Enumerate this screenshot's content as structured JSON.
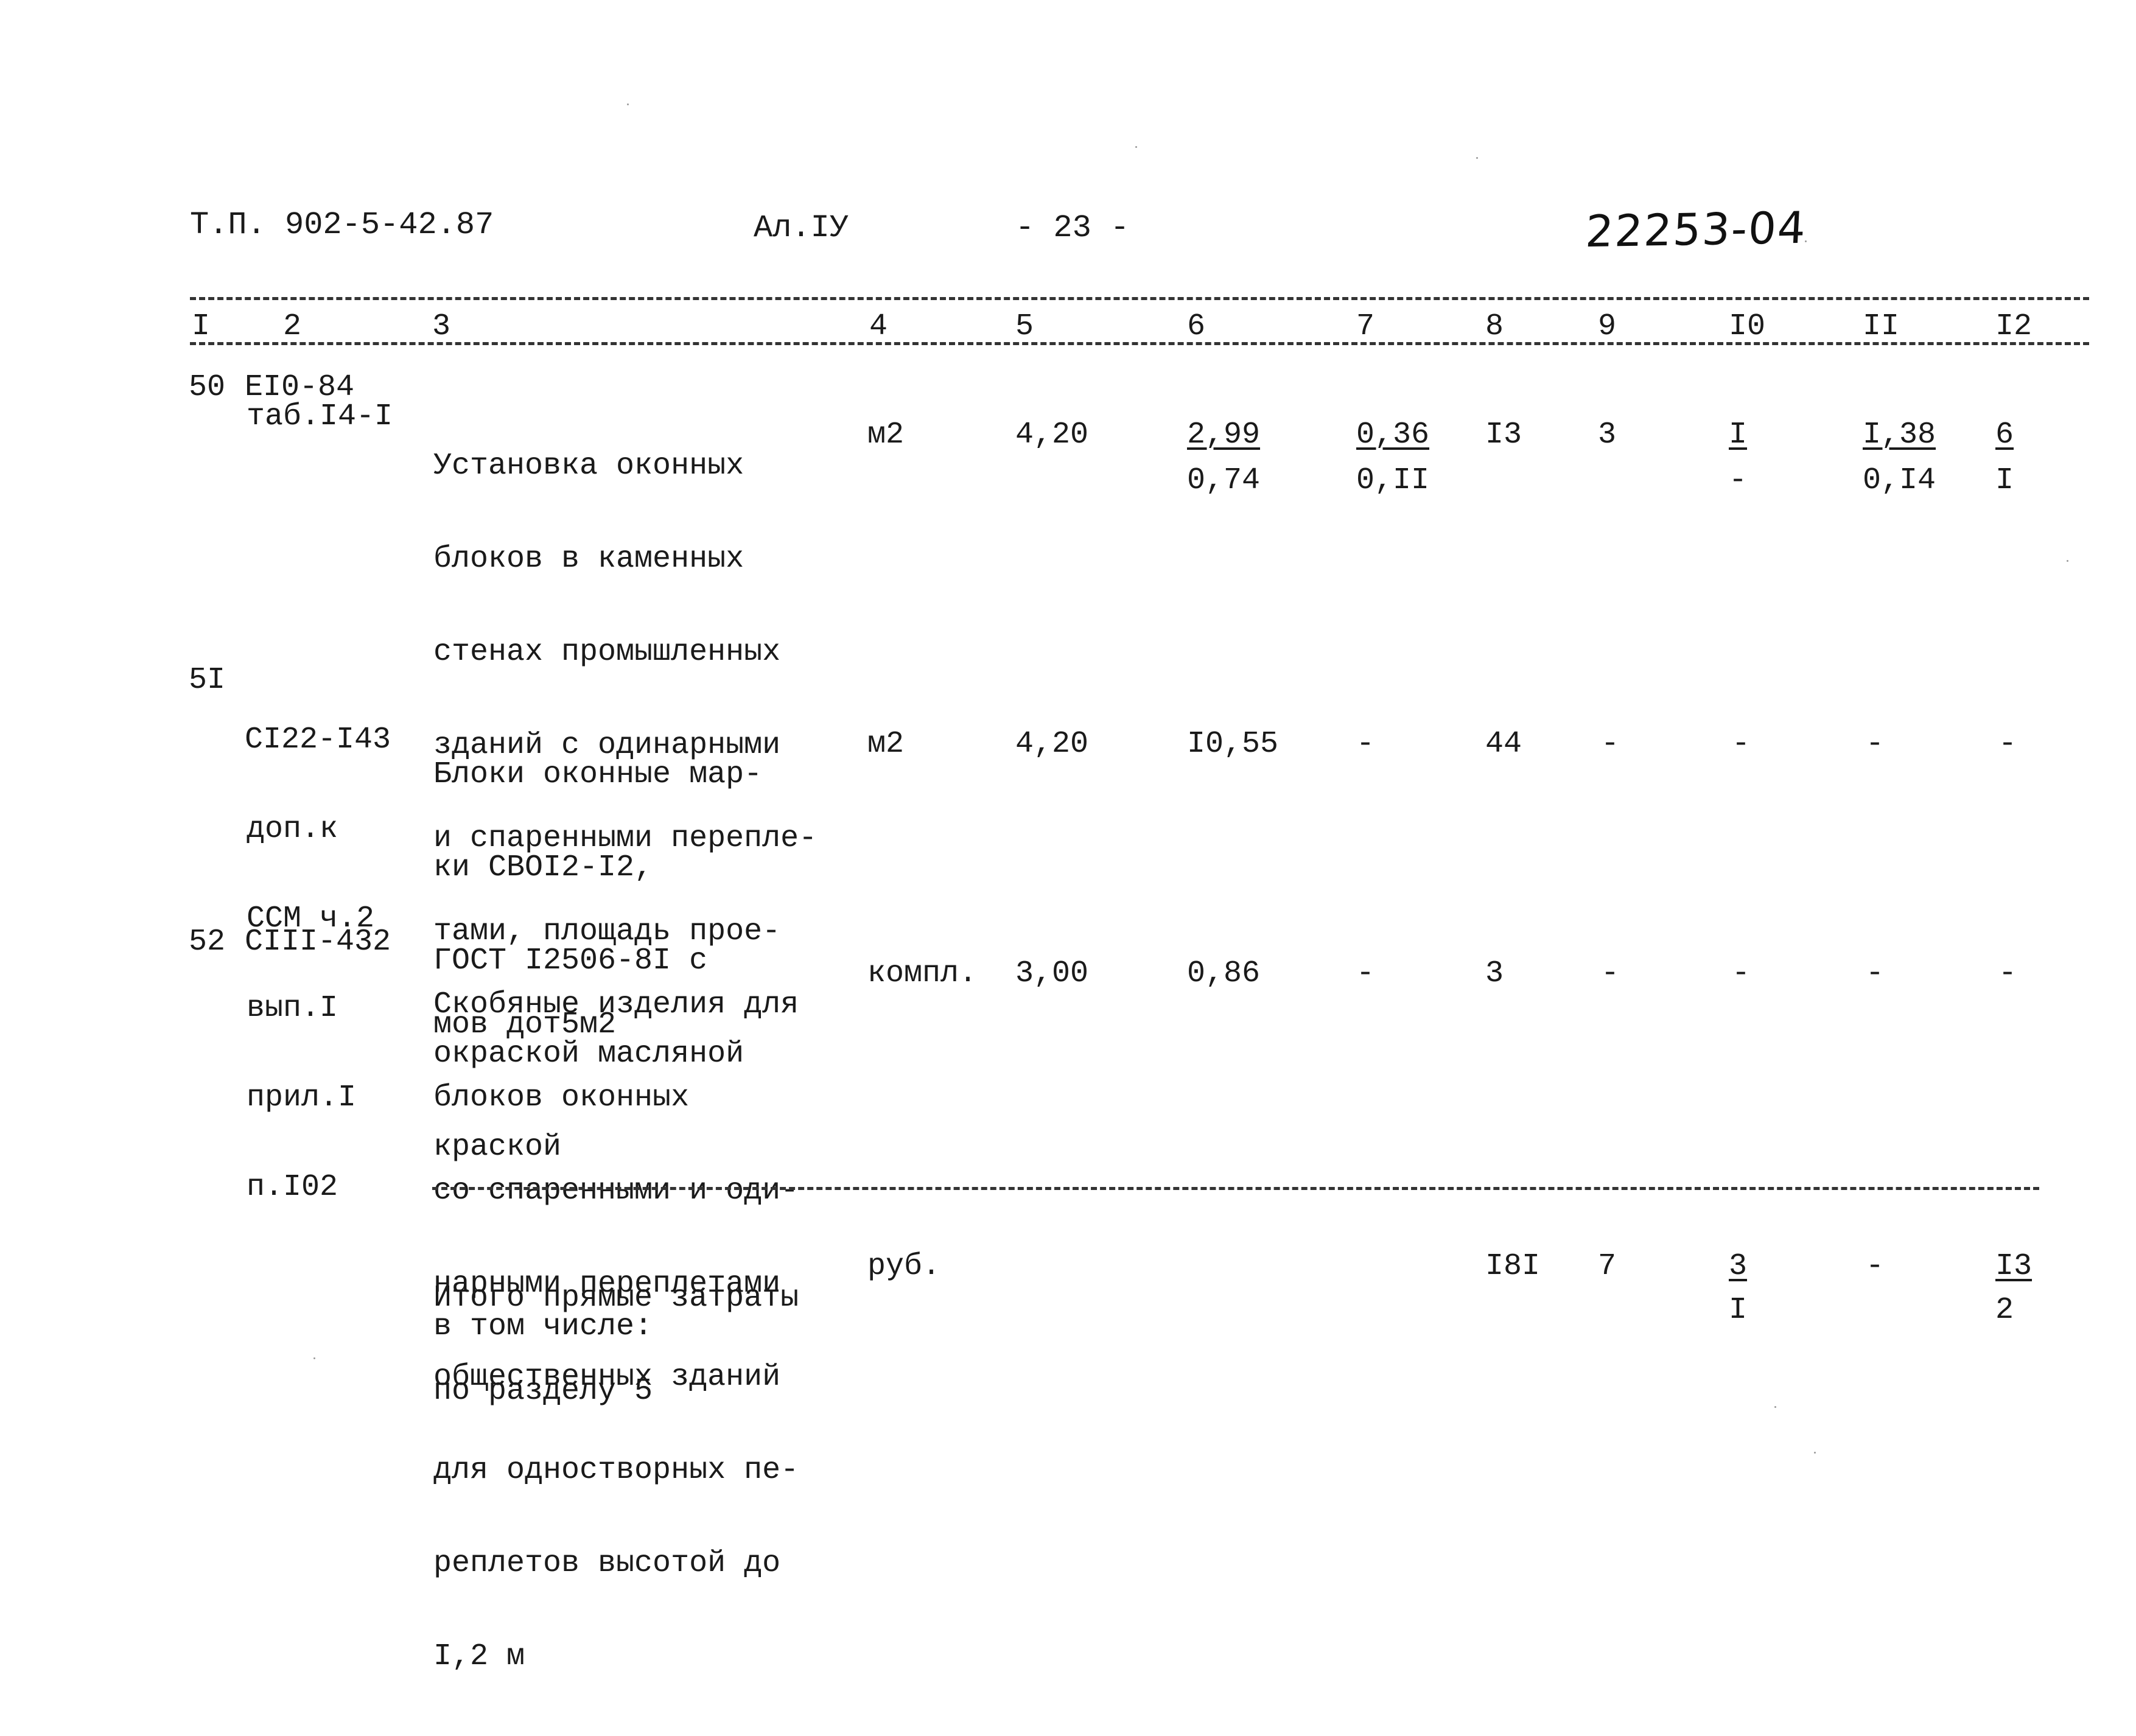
{
  "header": {
    "project_code": "Т.П. 902-5-42.87",
    "album": "Ал.IУ",
    "page_number": "- 23 -",
    "document_number": "22253-04"
  },
  "column_numbers": [
    "I",
    "2",
    "3",
    "4",
    "5",
    "6",
    "7",
    "8",
    "9",
    "I0",
    "II",
    "I2"
  ],
  "rows": [
    {
      "number": "50",
      "code_lines": [
        "EI0-84",
        "таб.I4-I"
      ],
      "description_lines": [
        "Установка оконных",
        "блоков в каменных",
        "стенах промышленных",
        "зданий с одинарными",
        "и спаренными перепле-",
        "тами, площадь прое-",
        "мов дот5м2"
      ],
      "unit": "м2",
      "quantity": "4,20",
      "c6": {
        "top": "2,99",
        "bottom": "0,74"
      },
      "c7": {
        "top": "0,36",
        "bottom": "0,II"
      },
      "c8": "I3",
      "c9": "3",
      "c10": {
        "top": "I",
        "bottom": "-"
      },
      "c11": {
        "top": "I,38",
        "bottom": "0,I4"
      },
      "c12": {
        "top": "6",
        "bottom": "I"
      }
    },
    {
      "number": "5I",
      "code_lines": [
        "CI22-I43",
        "доп.к",
        "ССМ ч.2",
        "вып.I",
        "прил.I",
        "п.I02"
      ],
      "description_lines": [
        "Блоки оконные мар-",
        "ки СВОI2-I2,",
        "ГОСТ I2506-8I с",
        "окраской масляной",
        "краской"
      ],
      "unit": "м2",
      "quantity": "4,20",
      "c6": "I0,55",
      "c7": "-",
      "c8": "44",
      "c9": "-",
      "c10": "-",
      "c11": "-",
      "c12": "-"
    },
    {
      "number": "52",
      "code_lines": [
        "CIII-432"
      ],
      "description_lines": [
        "Скобяные изделия для",
        "блоков оконных",
        "со спаренными и оди-",
        "нарными переплетами",
        "общественных зданий",
        "для одностворных пе-",
        "реплетов высотой до",
        "I,2 м"
      ],
      "unit": "компл.",
      "quantity": "3,00",
      "c6": "0,86",
      "c7": "-",
      "c8": "3",
      "c9": "-",
      "c10": "-",
      "c11": "-",
      "c12": "-"
    }
  ],
  "total": {
    "label_lines": [
      "Итого прямые затраты",
      "по разделу 5"
    ],
    "unit": "руб.",
    "c8": "I8I",
    "c9": "7",
    "c10": {
      "top": "3",
      "bottom": "I"
    },
    "c11": "-",
    "c12": {
      "top": "I3",
      "bottom": "2"
    },
    "including_label": "в том числе:"
  }
}
